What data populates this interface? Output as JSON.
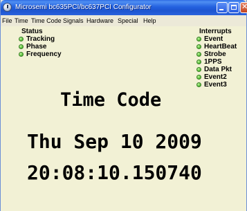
{
  "window": {
    "title": "Microsemi bc635PCI/bc637PCI Configurator"
  },
  "menu": [
    {
      "label": "File"
    },
    {
      "label": "Time"
    },
    {
      "label": "Time Code"
    },
    {
      "label": "Signals"
    },
    {
      "label": "Hardware"
    },
    {
      "label": "Special"
    },
    {
      "label": "Help"
    }
  ],
  "status": {
    "title": "Status",
    "items": [
      {
        "label": "Tracking",
        "state": "on",
        "color": "#4fbf3a"
      },
      {
        "label": "Phase",
        "state": "on",
        "color": "#4fbf3a"
      },
      {
        "label": "Frequency",
        "state": "on",
        "color": "#4fbf3a"
      }
    ]
  },
  "interrupts": {
    "title": "Interrupts",
    "items": [
      {
        "label": "Event",
        "state": "on",
        "color": "#4fbf3a"
      },
      {
        "label": "HeartBeat",
        "state": "on",
        "color": "#4fbf3a"
      },
      {
        "label": "Strobe",
        "state": "on",
        "color": "#4fbf3a"
      },
      {
        "label": "1PPS",
        "state": "on",
        "color": "#4fbf3a"
      },
      {
        "label": "Data Pkt",
        "state": "on",
        "color": "#4fbf3a"
      },
      {
        "label": "Event2",
        "state": "on",
        "color": "#4fbf3a"
      },
      {
        "label": "Event3",
        "state": "on",
        "color": "#4fbf3a"
      }
    ]
  },
  "display": {
    "mode": "Time Code",
    "date": "Thu Sep 10 2009",
    "time": "20:08:10.150740"
  },
  "colors": {
    "titlebar": "#2461df",
    "content_bg": "#f2f1d5",
    "led_on": "#4fbf3a"
  }
}
